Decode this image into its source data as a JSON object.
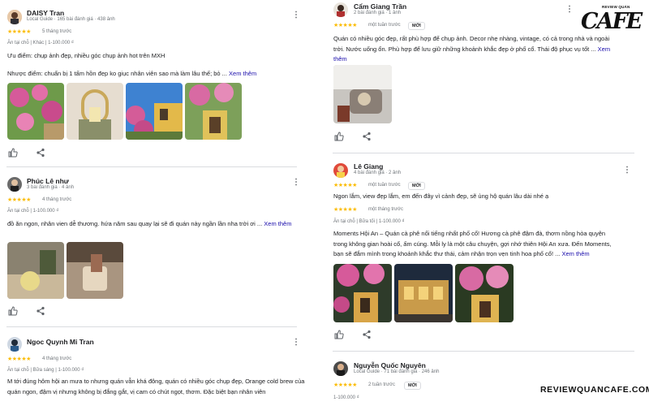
{
  "brand": {
    "logo_small": "REVIEW QUÁN",
    "logo_big": "CAFE",
    "watermark": "REVIEWQUANCAFE.COM"
  },
  "left_reviews": [
    {
      "name": "DAISY Tran",
      "meta": "Local Guide · 165 bài đánh giá · 438 ảnh",
      "stars": "★★★★★",
      "when": "5 tháng trước",
      "tags": "Ăn tại chỗ  |  Khác  |  1-100.000 ₫",
      "text1": "Ưu điểm: chụp ảnh đẹp, nhiều góc chụp ảnh hot trên MXH",
      "text2": "Nhược điểm: chuẩn bị 1 tấm hồn đẹp ko giục nhân viên sao mà làm lâu thế; bỏ ...",
      "more_label": "Xem thêm"
    },
    {
      "name": "Phúc Lê như",
      "meta": "3 bài đánh giá · 4 ảnh",
      "stars": "★★★★★",
      "when": "4 tháng trước",
      "tags": "Ăn tại chỗ  |  1-100.000 ₫",
      "text1": "đồ ăn ngon, nhân vien dễ thương. hứa năm sau quay lại sẽ đi quán này ngần lần nha trời ơi ...",
      "more_label": "Xem thêm"
    },
    {
      "name": "Ngoc Quynh Mi Tran",
      "meta": "",
      "stars": "★★★★★",
      "when": "4 tháng trước",
      "tags": "Ăn tại chỗ  |  Bữa sáng  |  1-100.000 ₫",
      "text1": "M tới đúng hôm hội an mưa to nhưng quán vẫn khá đông, quán có nhiều góc chụp đẹp, Orange cold brew của quán ngon, đậm vị nhưng không bị đắng gắt, vị cam có chút ngọt, thơm. Đặc biệt bạn nhân viên"
    }
  ],
  "right_reviews": [
    {
      "name": "Cẩm Giang Trần",
      "meta": "2 bài đánh giá · 1 ảnh",
      "stars": "★★★★★",
      "when": "một tuần trước",
      "badge": "MỚI",
      "text1": "Quán có nhiều góc đẹp, rất phù hợp để chụp ảnh. Decor nhẹ nhàng, vintage, có cả trong nhà và ngoài trời. Nước uống ổn. Phù hợp để lưu giữ những khoảnh khắc đẹp ở phố cổ. Thái độ phục vụ tốt ...",
      "more_label": "Xem thêm"
    },
    {
      "name": "Lê Giang",
      "meta": "4 bài đánh giá · 2 ảnh",
      "stars": "★★★★★",
      "when": "một tuần trước",
      "badge": "MỚI",
      "text1": "Ngon lắm, view đẹp lắm, em đến đây vì cảnh đẹp, sẽ ủng hộ quán lâu dài nhé ạ",
      "stars2": "★★★★★",
      "when2": "một tháng trước",
      "tags": "Ăn tại chỗ  |  Bữa tối  |  1-100.000 ₫",
      "text2": "Moments Hội An – Quán cà phê nổi tiếng nhất phố cổ! Hương cà phê đậm đà, thơm nồng hòa quyện trong không gian hoài cổ, ấm cúng. Mỗi ly là một câu chuyện, gợi nhớ thiên Hội An xưa. Đến Moments, bạn sẽ đắm mình trong khoảnh khắc thư thái, cảm nhận trọn vẹn tinh hoa phố cổ! ...",
      "more_label": "Xem thêm"
    },
    {
      "name": "Nguyễn Quốc Nguyên",
      "meta": "Local Guide · 71 bài đánh giá · 246 ảnh",
      "stars": "★★★★★",
      "when": "2 tuần trước",
      "badge": "MỚI",
      "tags": "1-100.000 ₫"
    }
  ],
  "icons": [
    "thumbs-up-icon",
    "share-icon",
    "more-vert-icon",
    "star-icon"
  ],
  "colors": {
    "star": "#fbbc04",
    "link": "#1a0dab",
    "divider": "#dadce0"
  }
}
